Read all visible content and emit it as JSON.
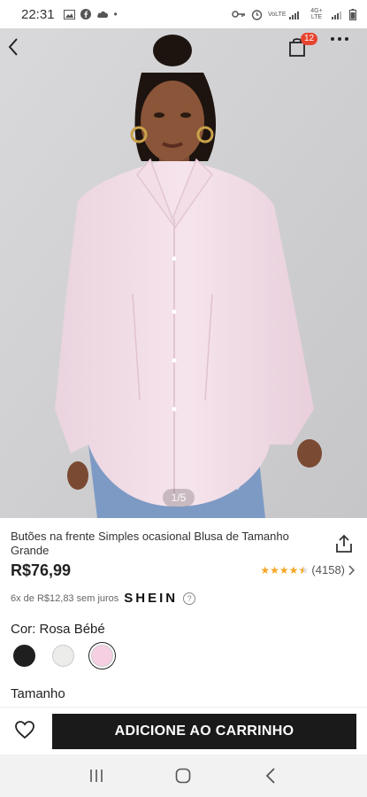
{
  "status_bar": {
    "time": "22:31",
    "icons_left": [
      "image-icon",
      "facebook-icon",
      "cloud-icon",
      "dot-icon"
    ],
    "icons_right": [
      "key-icon",
      "alarm-icon",
      "volte-icon",
      "signal-icon",
      "battery-icon"
    ],
    "volte_label": "VoLTE",
    "network_label": "4G+ LTE"
  },
  "header": {
    "cart_count": "12"
  },
  "gallery": {
    "counter": "1/5"
  },
  "product": {
    "title": "Butões na frente Simples ocasional Blusa de Tamanho Grande",
    "price": "R$76,99",
    "rating_stars": 4.5,
    "review_count": "(4158)",
    "installments": "6x de R$12,83 sem juros",
    "brand": "SHEIN",
    "color_label": "Cor: Rosa Bébé",
    "colors": [
      {
        "name": "black",
        "hex": "#1f1f1f"
      },
      {
        "name": "off-white",
        "hex": "#ececea"
      },
      {
        "name": "pink",
        "hex": "#f6cfe3"
      }
    ],
    "selected_color_index": 2,
    "size_label": "Tamanho"
  },
  "actions": {
    "add_to_cart": "ADICIONE AO CARRINHO"
  },
  "colors": {
    "badge": "#e64530",
    "star": "#f5a623",
    "button_bg": "#1a1a1a",
    "shirt": "#f4dfe8"
  }
}
